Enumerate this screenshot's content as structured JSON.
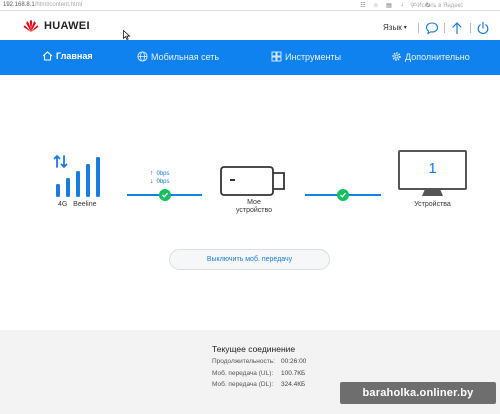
{
  "browser": {
    "url_host": "192.168.8.1",
    "url_path": "/html/content.html",
    "search_placeholder": "Искать в Яндекс"
  },
  "header": {
    "logo_text": "HUAWEI",
    "language": "Язык"
  },
  "nav": {
    "items": [
      {
        "label": "Главная",
        "icon": "home-icon",
        "active": true
      },
      {
        "label": "Мобильная сеть",
        "icon": "globe-icon",
        "active": false
      },
      {
        "label": "Инструменты",
        "icon": "tools-icon",
        "active": false
      },
      {
        "label": "Дополнительно",
        "icon": "gear-icon",
        "active": false
      }
    ]
  },
  "status": {
    "network": "4G   Beeline",
    "upload_speed": "0bps",
    "download_speed": "0bps",
    "device_label": "Мое устройство",
    "devices_count": "1",
    "devices_label": "Устройства",
    "disable_button": "Выключить моб. передачу"
  },
  "connection": {
    "title": "Текущее соединение",
    "rows": [
      {
        "label": "Продолжительность:",
        "value": "00:26:00"
      },
      {
        "label": "Моб. передача (UL):",
        "value": "100.7КБ"
      },
      {
        "label": "Моб. передача (DL):",
        "value": "324.4КБ"
      }
    ]
  },
  "watermark": "baraholka.onliner.by",
  "colors": {
    "accent": "#0f82f0",
    "success": "#16c060",
    "logo_red": "#e60012"
  }
}
